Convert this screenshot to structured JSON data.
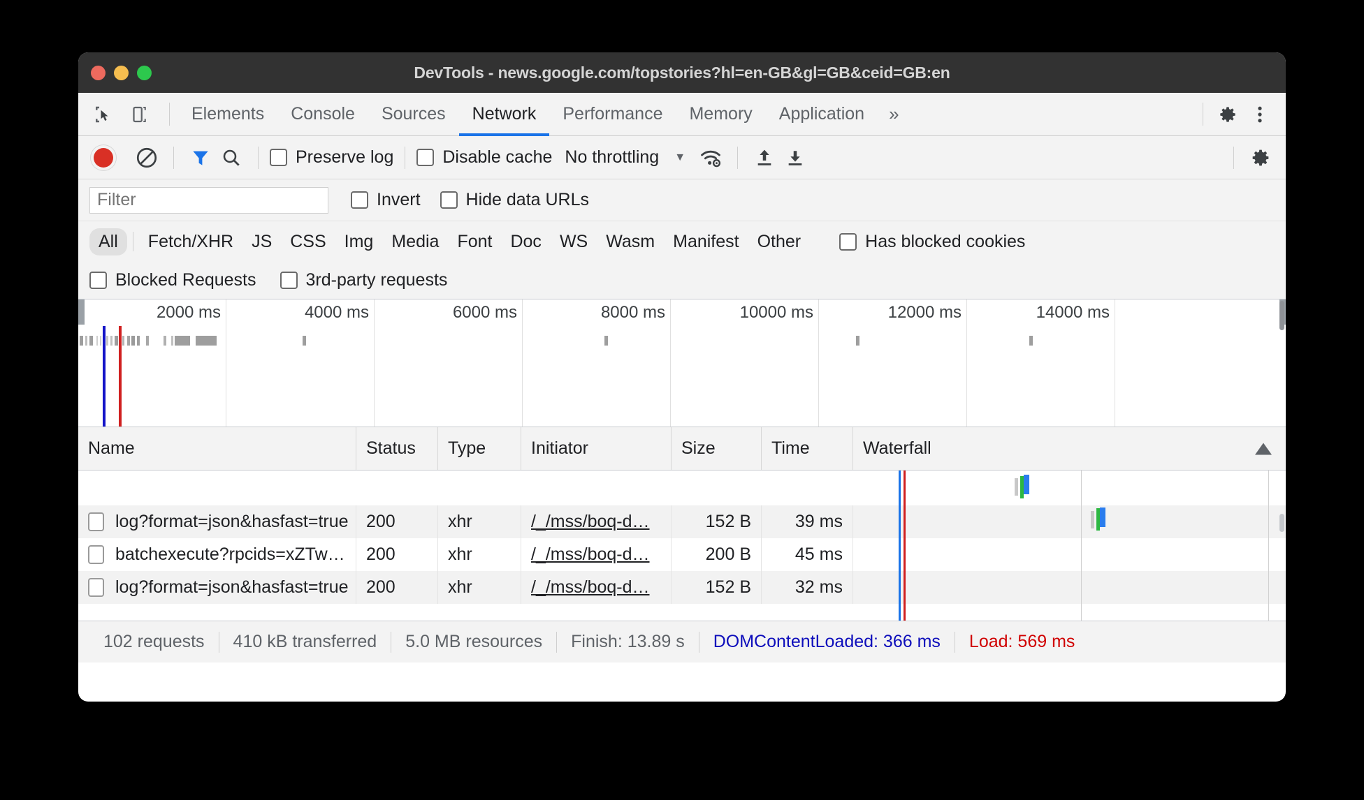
{
  "window": {
    "title": "DevTools - news.google.com/topstories?hl=en-GB&gl=GB&ceid=GB:en",
    "traffic": {
      "close": "close-button",
      "minimize": "minimize-button",
      "maximize": "maximize-button"
    }
  },
  "tabbar": {
    "tabs": [
      {
        "label": "Elements",
        "active": false
      },
      {
        "label": "Console",
        "active": false
      },
      {
        "label": "Sources",
        "active": false
      },
      {
        "label": "Network",
        "active": true
      },
      {
        "label": "Performance",
        "active": false
      },
      {
        "label": "Memory",
        "active": false
      },
      {
        "label": "Application",
        "active": false
      }
    ],
    "more": "»",
    "settings_icon": "gear-icon",
    "menu_icon": "kebab-menu-icon",
    "inspect_icon": "inspect-element-icon",
    "device_icon": "device-toolbar-icon"
  },
  "network_toolbar": {
    "record_label": "record-button",
    "clear_label": "clear-button",
    "filter_icon": "filter-funnel-icon",
    "search_icon": "search-magnifier-icon",
    "preserve_log": {
      "label": "Preserve log",
      "checked": false
    },
    "disable_cache": {
      "label": "Disable cache",
      "checked": false
    },
    "throttling": {
      "value": "No throttling",
      "caret": "▼"
    },
    "wifi_icon": "network-conditions-icon",
    "import_icon": "import-har-icon",
    "export_icon": "export-har-icon",
    "settings_icon": "network-settings-gear-icon"
  },
  "filter_bar": {
    "input_value": "",
    "input_placeholder": "Filter",
    "invert": {
      "label": "Invert",
      "checked": false
    },
    "hide_data_urls": {
      "label": "Hide data URLs",
      "checked": false
    }
  },
  "type_filters": {
    "chips": [
      "All",
      "Fetch/XHR",
      "JS",
      "CSS",
      "Img",
      "Media",
      "Font",
      "Doc",
      "WS",
      "Wasm",
      "Manifest",
      "Other"
    ],
    "active": "All",
    "has_blocked_cookies": {
      "label": "Has blocked cookies",
      "checked": false
    }
  },
  "blocked_bar": {
    "blocked_requests": {
      "label": "Blocked Requests",
      "checked": false
    },
    "third_party_requests": {
      "label": "3rd-party requests",
      "checked": false
    }
  },
  "overview": {
    "ticks": [
      "2000 ms",
      "4000 ms",
      "6000 ms",
      "8000 ms",
      "10000 ms",
      "12000 ms",
      "14000 ms"
    ],
    "dom_content_loaded_color": "#1414c8",
    "load_color": "#d02020"
  },
  "table": {
    "columns": [
      "Name",
      "Status",
      "Type",
      "Initiator",
      "Size",
      "Time",
      "Waterfall"
    ],
    "sort_column": "Waterfall",
    "sort_direction": "ascending",
    "rows": [
      {
        "name": "log?format=json&hasfast=true",
        "status": "200",
        "type": "xhr",
        "initiator": "/_/mss/boq-d…",
        "size": "152 B",
        "time": "39 ms"
      },
      {
        "name": "batchexecute?rpcids=xZTw…",
        "status": "200",
        "type": "xhr",
        "initiator": "/_/mss/boq-d…",
        "size": "200 B",
        "time": "45 ms"
      },
      {
        "name": "log?format=json&hasfast=true",
        "status": "200",
        "type": "xhr",
        "initiator": "/_/mss/boq-d…",
        "size": "152 B",
        "time": "32 ms"
      }
    ]
  },
  "status_bar": {
    "requests": "102 requests",
    "transferred": "410 kB transferred",
    "resources": "5.0 MB resources",
    "finish": "Finish: 13.89 s",
    "dom_content_loaded": "DOMContentLoaded: 366 ms",
    "load": "Load: 569 ms",
    "dom_content_loaded_color": "#0d0dbb",
    "load_color": "#d00000"
  }
}
